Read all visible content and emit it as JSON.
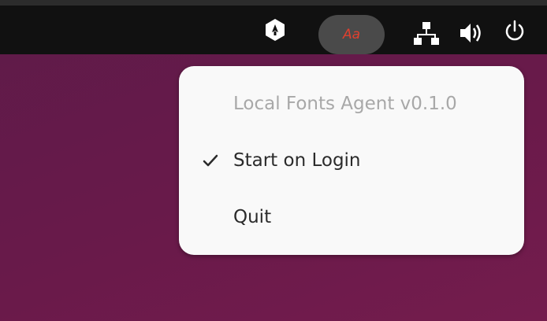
{
  "top_bar": {
    "font_indicator_text": "Aa",
    "icons": [
      "app-indicator-icon",
      "font-agent-icon",
      "network-icon",
      "volume-icon",
      "power-icon"
    ],
    "accent_color": "#e0402f"
  },
  "menu": {
    "header": "Local Fonts Agent v0.1.0",
    "items": [
      {
        "label": "Start on Login",
        "checked": true
      },
      {
        "label": "Quit",
        "checked": false
      }
    ]
  }
}
